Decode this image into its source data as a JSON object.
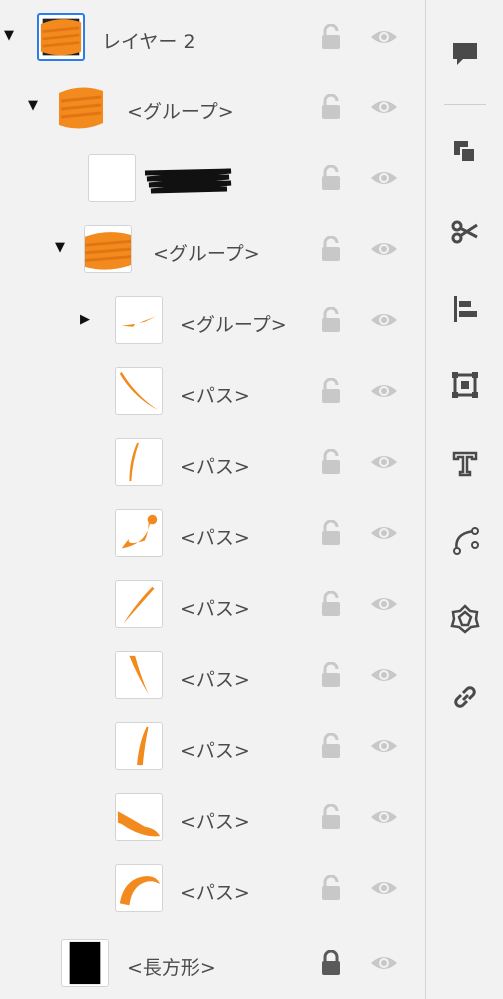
{
  "layers_panel": {
    "rows": [
      {
        "label": "レイヤー 2",
        "expanded": true
      },
      {
        "label": "<グループ>",
        "expanded": true
      },
      {
        "label": ""
      },
      {
        "label": "<グループ>",
        "expanded": true
      },
      {
        "label": "<グループ>",
        "expanded": false
      },
      {
        "label": "<パス>"
      },
      {
        "label": "<パス>"
      },
      {
        "label": "<パス>"
      },
      {
        "label": "<パス>"
      },
      {
        "label": "<パス>"
      },
      {
        "label": "<パス>"
      },
      {
        "label": "<パス>"
      },
      {
        "label": "<パス>"
      },
      {
        "label": "<長方形>",
        "locked": true
      }
    ]
  },
  "colors": {
    "accent_orange": "#f28a1e",
    "selection_blue": "#2b7de9",
    "icon_gray": "#c8c8c8"
  },
  "toolbar": {
    "tools": [
      "comment-icon",
      "arrange-icon",
      "scissors-icon",
      "align-icon",
      "transform-icon",
      "type-icon",
      "anchor-point-icon",
      "symbol-icon",
      "link-icon"
    ]
  }
}
